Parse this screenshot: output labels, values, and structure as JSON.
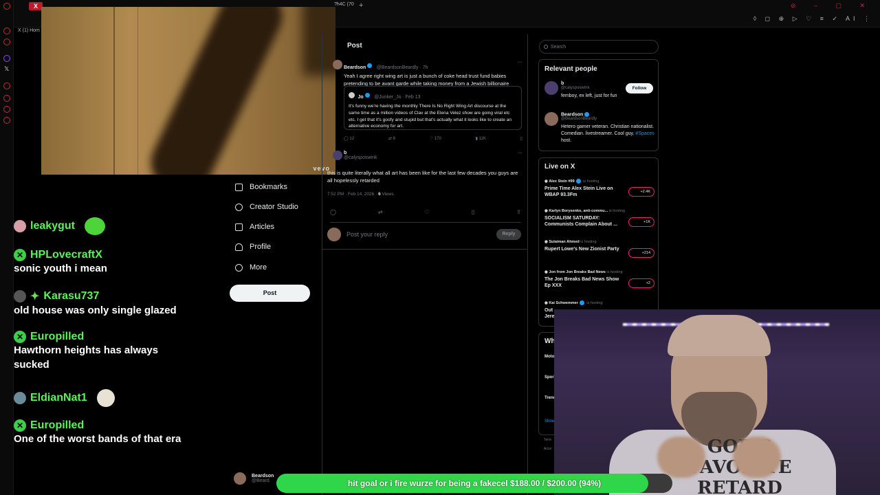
{
  "browser": {
    "tab_x": "X",
    "tab2_label": "?h4C (70",
    "new_tab": "+",
    "url_tab": "X (1) Hom",
    "toolbar_icons": "◊ ◻ ⊕ ▷ ♡ ≡ ✓ AI ⋮",
    "window_controls": "⊘ – ▢ ✕"
  },
  "video": {
    "watermark": "vevo"
  },
  "chat": [
    {
      "user": "leakygut",
      "text": ""
    },
    {
      "user": "HPLovecraftX",
      "text": "sonic youth i mean"
    },
    {
      "user": "Karasu737",
      "text": "old house was only single glazed"
    },
    {
      "user": "Europilled",
      "text": "Hawthorn heights has always sucked"
    },
    {
      "user": "EldianNat1",
      "text": ""
    },
    {
      "user": "Europilled",
      "text": "One of the worst bands of that era"
    }
  ],
  "nav": {
    "items": [
      {
        "label": "Bookmarks"
      },
      {
        "label": "Creator Studio"
      },
      {
        "label": "Articles"
      },
      {
        "label": "Profile"
      },
      {
        "label": "More"
      }
    ],
    "post_button": "Post",
    "account_name": "Beardson",
    "account_handle": "@Beard"
  },
  "post": {
    "header": "Post",
    "tweet1": {
      "name": "Beardson",
      "handle": "@BeardsonBeardly · 7h",
      "text": "Yeah I agree right wing art is just a bunch of coke head trust fund babies pretending to be avant garde while taking money from a Jewish billionaire"
    },
    "quote": {
      "name": "Jo",
      "handle": "@Junker_Jo · Feb 13",
      "text": "It's funny we're having the monthly There Is No Right Wing Art discourse at the same time as a million videos of Clav at the Elena Velez show are going viral etc etc. I get that it's goofy and stupid but that's actually what it looks like to create an alternative economy for art."
    },
    "tweet1_actions": {
      "replies": "12",
      "reposts": "8",
      "likes": "170",
      "views": "11K"
    },
    "tweet2": {
      "name": "b",
      "handle": "@calysposwink",
      "text": "this is quite literally what all art has been like for the last few decades you guys are all hopelessly retarded",
      "meta_time": "7:52 PM · Feb 14, 2026 · ",
      "meta_views": "6",
      "meta_views_label": " Views"
    },
    "reply_placeholder": "Post your reply",
    "reply_button": "Reply"
  },
  "search": {
    "placeholder": "Search"
  },
  "relevant": {
    "title": "Relevant people",
    "people": [
      {
        "name": "b",
        "handle": "@calysposwink",
        "bio": "femboy, ex left, just for fun",
        "follow": "Follow"
      },
      {
        "name": "Beardson",
        "handle": "@BeardsonBeardly",
        "bio_pre": "Hetero gamer veteran. Christian nationalist. Comedian. livestreamer. Cool guy. ",
        "bio_tag": "#Spaces",
        "bio_post": " host."
      }
    ]
  },
  "live": {
    "title": "Live on X",
    "hosting_label": "is hosting",
    "items": [
      {
        "host": "Alex Stein #99",
        "title": "Prime Time Alex Stein Live on WBAP 93.3Fm",
        "count": "+2.4K"
      },
      {
        "host": "Karlyn Borysenko, anti-commu...",
        "title": "SOCIALISM SATURDAY: Communists Complain About ...",
        "count": "+1K"
      },
      {
        "host": "Sulaiman Ahmed",
        "title": "Rupert Lowe's New Zionist Party",
        "count": "+214"
      },
      {
        "host": "Jon from Jon Breaks Bad News",
        "title": "The Jon Breaks Bad News Show Ep XXX",
        "count": "+2"
      },
      {
        "host": "Kai Schwemmer",
        "title": "Out Jere",
        "count": ""
      }
    ]
  },
  "whats_happening": {
    "title_partial": "Wh",
    "rows": [
      "Moto #NA",
      "Spor Billy",
      "Trend Tess",
      "Show"
    ]
  },
  "footer_partial": [
    "Term",
    "Acce"
  ],
  "webcam": {
    "shirt_text": "GOD'S FAVORITE RETARD"
  },
  "goal": {
    "text": "hit goal or i fire wurze for being a fakecel $188.00 / $200.00 (94%)",
    "current": 188.0,
    "target": 200.0,
    "percent": 94
  },
  "colors": {
    "chat_name": "#5cf25a",
    "accent_blue": "#1d9bf0",
    "live_ring": "#f91880",
    "goal_fill": "#30d64a",
    "browser_red": "#c0182d"
  }
}
